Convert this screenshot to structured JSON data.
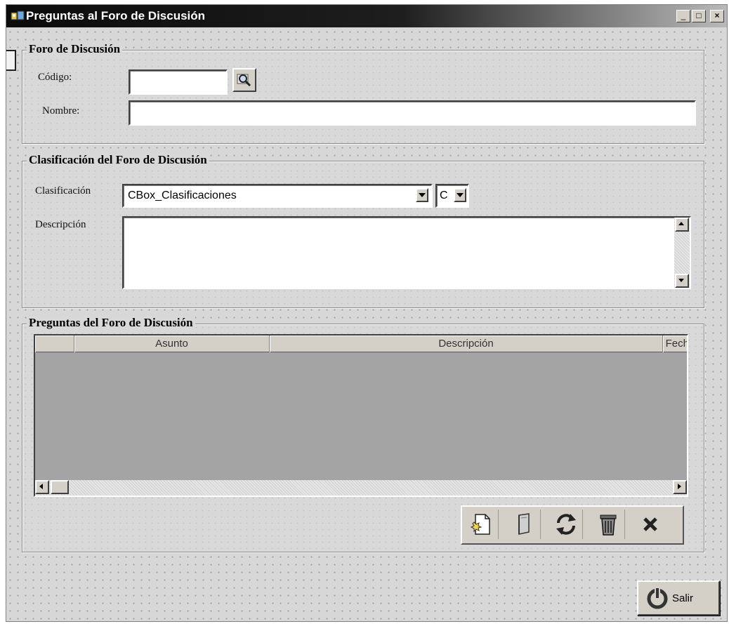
{
  "window": {
    "title": "Preguntas al Foro de Discusión",
    "minimize_label": "_",
    "maximize_label": "□",
    "close_label": "×"
  },
  "foro": {
    "legend": "Foro de Discusión",
    "codigo_label": "Código:",
    "codigo_value": "",
    "nombre_label": "Nombre:",
    "nombre_value": ""
  },
  "clasificacion": {
    "legend": "Clasificación del Foro de Discusión",
    "clasificacion_label": "Clasificación",
    "combo_value": "CBox_Clasificaciones",
    "combo2_value": "C",
    "descripcion_label": "Descripción",
    "descripcion_value": ""
  },
  "preguntas": {
    "legend": "Preguntas del Foro de Discusión",
    "columns": [
      "",
      "Asunto",
      "Descripción",
      "Fech"
    ],
    "rows": []
  },
  "toolbar": {
    "buttons": [
      {
        "icon": "new-document-icon"
      },
      {
        "icon": "edit-book-icon"
      },
      {
        "icon": "refresh-icon"
      },
      {
        "icon": "trash-icon"
      },
      {
        "icon": "cancel-x-icon"
      }
    ]
  },
  "footer": {
    "salir_label": "Salir",
    "salir_icon": "power-icon"
  }
}
